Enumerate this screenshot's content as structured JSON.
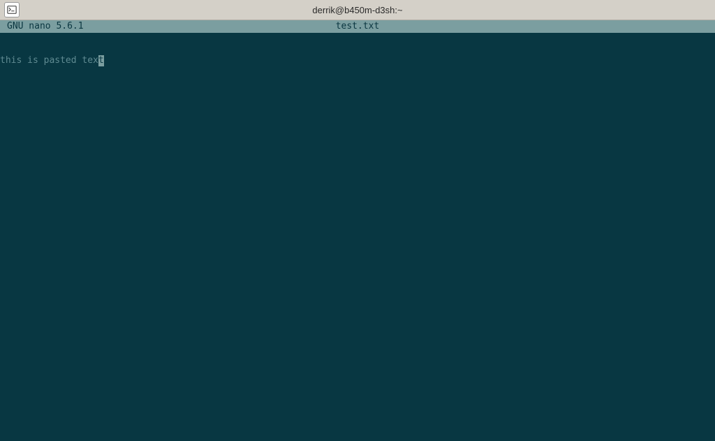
{
  "window": {
    "title": "derrik@b450m-d3sh:~"
  },
  "nano": {
    "version": "GNU nano 5.6.1",
    "filename": "test.txt",
    "content_prefix": "this is pasted tex",
    "cursor_char": "t"
  }
}
